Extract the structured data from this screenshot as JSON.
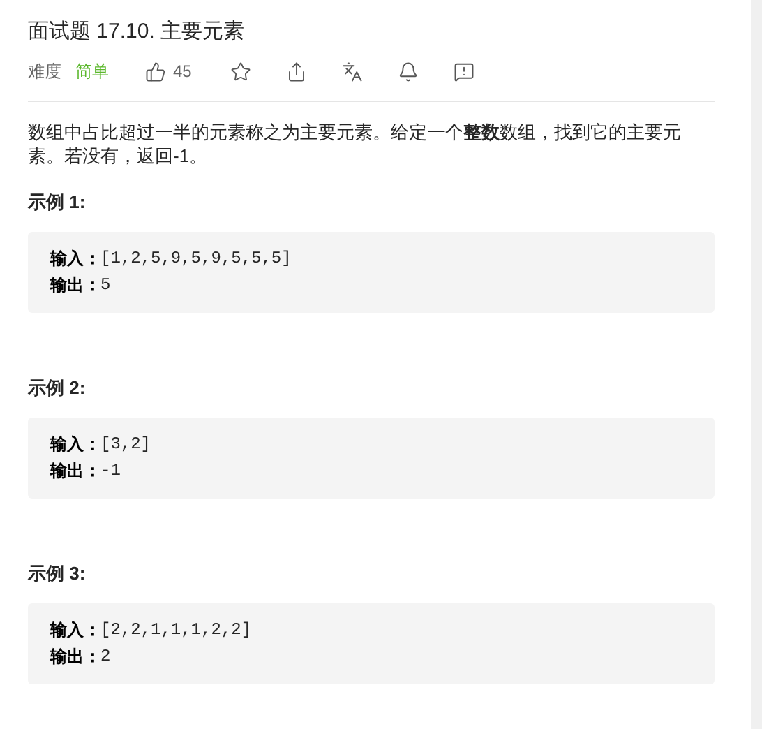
{
  "title": "面试题 17.10. 主要元素",
  "meta": {
    "difficulty_label": "难度",
    "difficulty": "简单",
    "likes": "45"
  },
  "description": "数组中占比超过一半的元素称之为主要元素。给定一个**整数**数组，找到它的主要元素。若没有，返回-1。",
  "examples": [
    {
      "title": "示例 1:",
      "lines": [
        {
          "label": "输入：",
          "value": "[1,2,5,9,5,9,5,5,5]"
        },
        {
          "label": "输出：",
          "value": "5"
        }
      ]
    },
    {
      "title": "示例 2:",
      "lines": [
        {
          "label": "输入：",
          "value": "[3,2]"
        },
        {
          "label": "输出：",
          "value": "-1"
        }
      ]
    },
    {
      "title": "示例 3:",
      "lines": [
        {
          "label": "输入：",
          "value": "[2,2,1,1,1,2,2]"
        },
        {
          "label": "输出：",
          "value": "2"
        }
      ]
    }
  ]
}
